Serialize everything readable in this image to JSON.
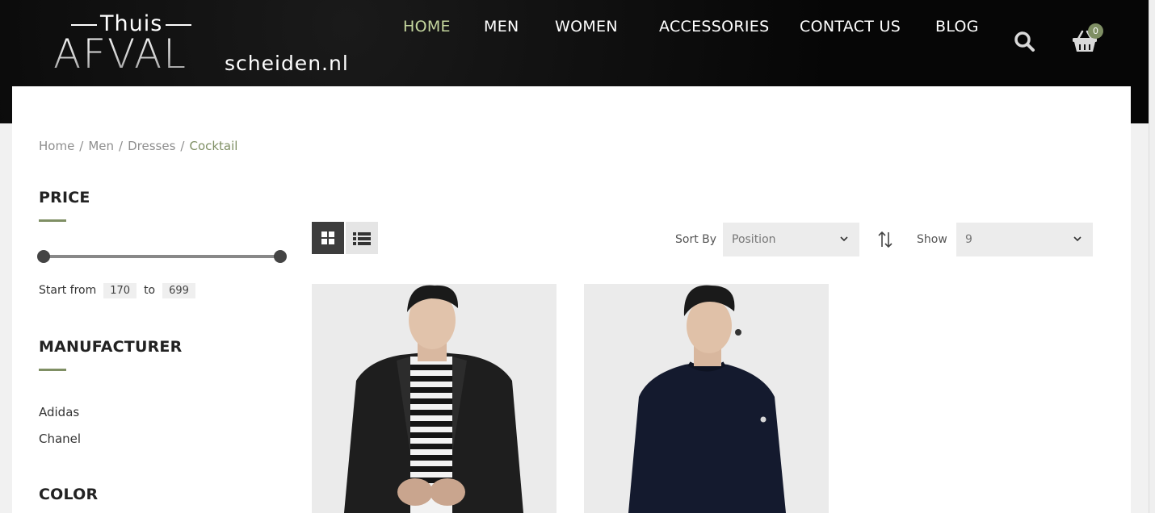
{
  "logo": {
    "top": "Thuis",
    "main": "AFVAL",
    "suffix": "scheiden.nl"
  },
  "nav": [
    {
      "label": "HOME",
      "active": true
    },
    {
      "label": "MEN",
      "active": false
    },
    {
      "label": "WOMEN",
      "active": false
    },
    {
      "label": "ACCESSORIES",
      "active": false
    },
    {
      "label": "CONTACT US",
      "active": false
    },
    {
      "label": "BLOG",
      "active": false
    }
  ],
  "icons": {
    "search": "search-icon",
    "cart": "basket-icon"
  },
  "cart": {
    "count": "0"
  },
  "breadcrumb": {
    "items": [
      "Home",
      "Men",
      "Dresses"
    ],
    "current": "Cocktail"
  },
  "filters": {
    "price": {
      "title": "PRICE",
      "start_label": "Start from",
      "to_label": "to",
      "min": "170",
      "max": "699"
    },
    "manufacturer": {
      "title": "MANUFACTURER",
      "items": [
        "Adidas",
        "Chanel"
      ]
    },
    "color": {
      "title": "COLOR"
    }
  },
  "toolbar": {
    "sort_label": "Sort By",
    "sort_value": "Position",
    "show_label": "Show",
    "show_value": "9"
  },
  "products": [
    {
      "image": "man-black-blazer-striped-shirt"
    },
    {
      "image": "man-navy-sweater"
    }
  ],
  "colors": {
    "accent": "#7f8f64",
    "nav_active": "#c4d69e",
    "header_bg": "#050505"
  }
}
